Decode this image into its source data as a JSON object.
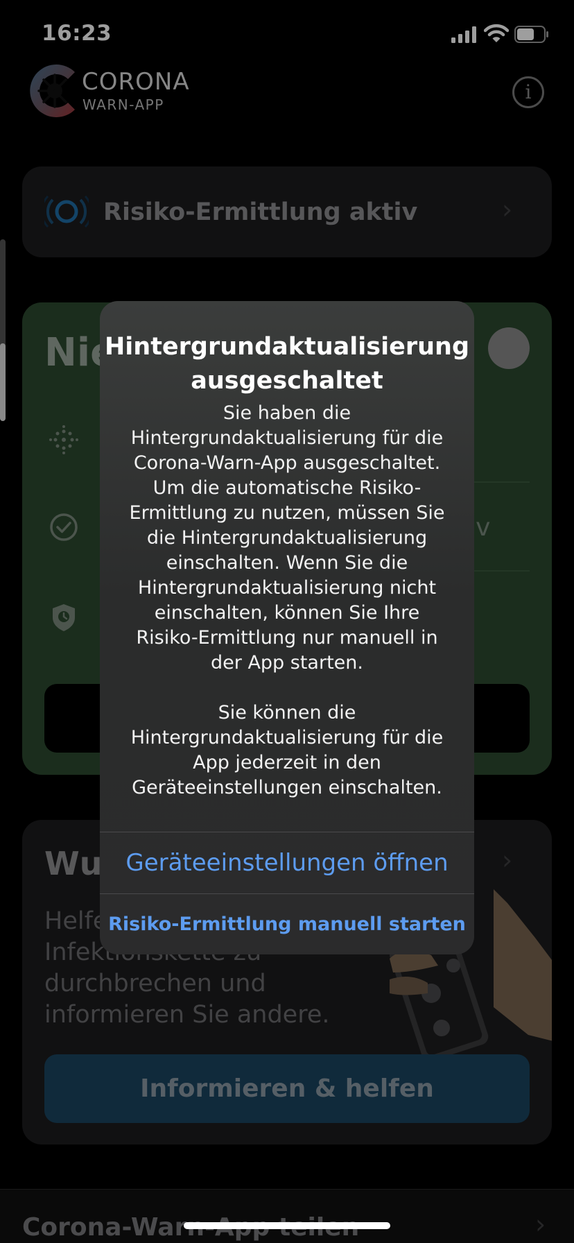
{
  "status_bar": {
    "time": "16:23"
  },
  "header": {
    "logo_line1": "CORONA",
    "logo_line2": "WARN-APP",
    "info_icon": "info-icon"
  },
  "risk_card": {
    "label": "Risiko-Ermittlung aktiv",
    "icon": "radar-icon"
  },
  "green_card": {
    "title_visible": "Nie",
    "row2_tail": "tiv"
  },
  "inform_card": {
    "title_visible": "Wu",
    "text_lines": [
      "Helfe",
      "Infektionskette zu",
      "durchbrechen und",
      "informieren Sie andere."
    ],
    "button_label": "Informieren & helfen"
  },
  "share_row": {
    "label": "Corona-Warn-App teilen"
  },
  "dialog": {
    "title": "Hintergrundaktualisierung ausgeschaltet",
    "message": "Sie haben die\nHintergrundaktualisierung für die\nCorona-Warn-App ausgeschaltet.\nUm die automatische Risiko-\nErmittlung zu nutzen, müssen Sie\ndie Hintergrundaktualisierung\neinschalten. Wenn Sie die\nHintergrundaktualisierung nicht\neinschalten, können Sie Ihre\nRisiko-Ermittlung nur manuell in\nder App starten.\n\nSie können die\nHintergrundaktualisierung für die\nApp jederzeit in den\nGeräteeinstellungen einschalten.",
    "primary_action": "Geräteeinstellungen öffnen",
    "secondary_action": "Risiko-Ermittlung manuell starten",
    "action_color": "#5d9cf0"
  }
}
